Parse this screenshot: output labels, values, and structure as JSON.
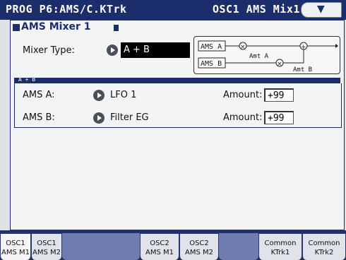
{
  "title_bar": {
    "left_text": "PROG P6:AMS/C.KTrk",
    "right_text": "OSC1 AMS Mix1",
    "menu_icon": "chevron-down-icon"
  },
  "section": {
    "title": "AMS Mixer 1"
  },
  "mixer_type": {
    "label": "Mixer Type:",
    "value": "A + B"
  },
  "diagram": {
    "ams_a": "AMS A",
    "ams_b": "AMS B",
    "amt_a": "Amt A",
    "amt_b": "Amt B"
  },
  "subsection": {
    "title": "A + B"
  },
  "ams_a": {
    "label": "AMS A:",
    "value": "LFO 1",
    "amount_label": "Amount:",
    "amount_value": "+99"
  },
  "ams_b": {
    "label": "AMS B:",
    "value": "Filter EG",
    "amount_label": "Amount:",
    "amount_value": "+99"
  },
  "tabs": [
    {
      "line1": "OSC1",
      "line2": "AMS M1"
    },
    {
      "line1": "OSC1",
      "line2": "AMS M2"
    },
    {
      "line1": "OSC2",
      "line2": "AMS M1"
    },
    {
      "line1": "OSC2",
      "line2": "AMS M2"
    },
    {
      "line1": "Common",
      "line2": "KTrk1"
    },
    {
      "line1": "Common",
      "line2": "KTrk2"
    }
  ],
  "colors": {
    "accent": "#1c2d6b",
    "panel": "#f3f4f6",
    "tab_bg": "#23306e"
  }
}
